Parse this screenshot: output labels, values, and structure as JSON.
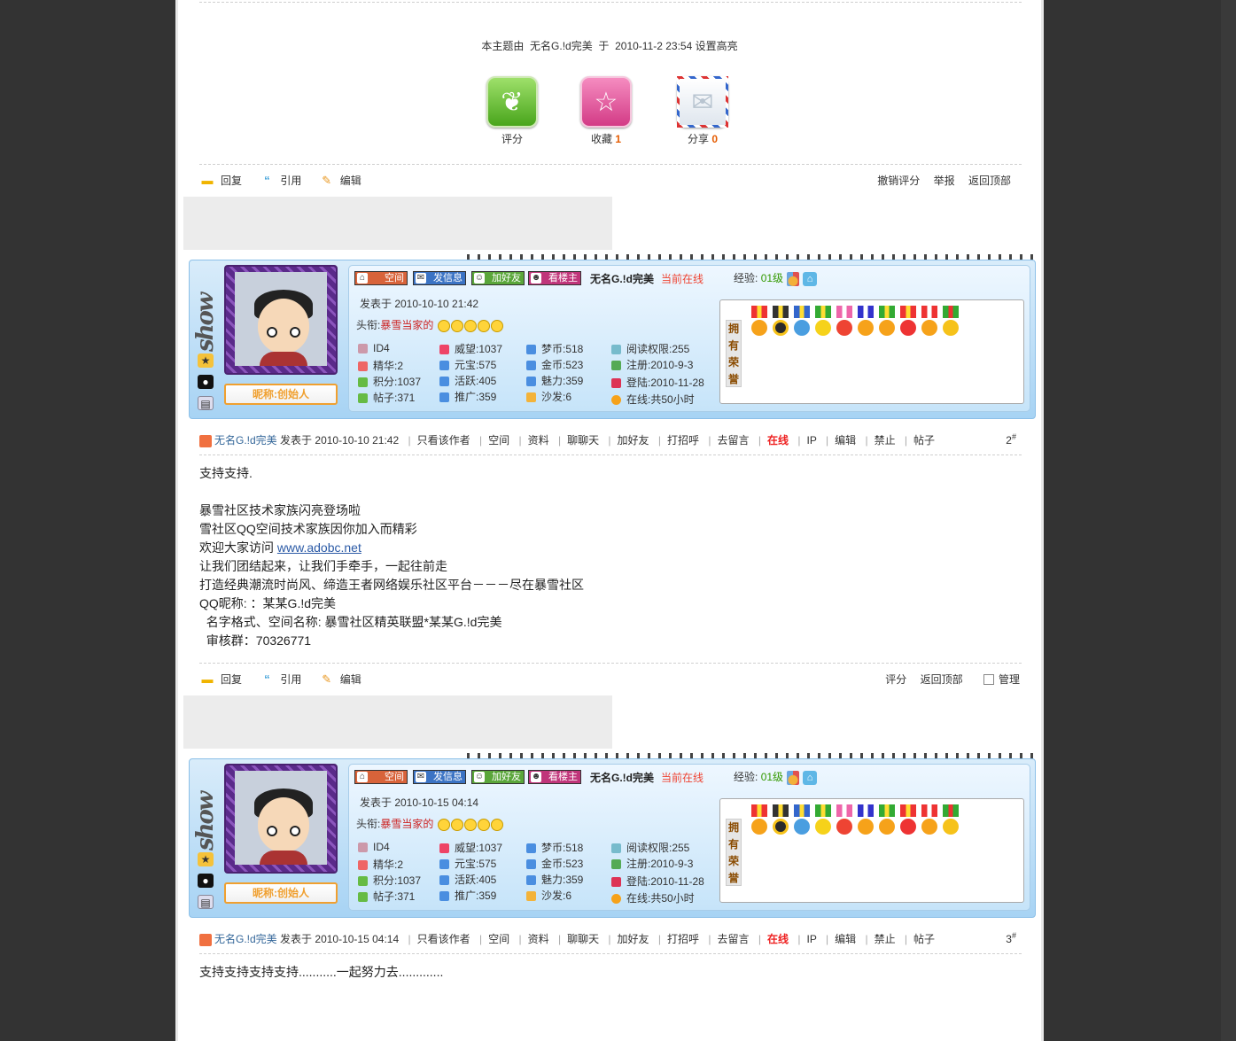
{
  "highlight_note": {
    "prefix": "本主题由",
    "user": "无名G.!d完美",
    "at": "于",
    "time": "2010-11-2 23:54",
    "suffix": "设置高亮"
  },
  "share": {
    "rate_label": "评分",
    "fav_label": "收藏",
    "fav_count": "1",
    "share_label": "分享",
    "share_count": "0"
  },
  "actions": {
    "reply": "回复",
    "quote": "引用",
    "edit": "编辑",
    "undo_rate": "撤销评分",
    "report": "举报",
    "back_top": "返回顶部",
    "rate": "评分",
    "manage": "管理"
  },
  "card_buttons": {
    "space": "空间",
    "message": "发信息",
    "add_friend": "加好友",
    "view_host": "看楼主"
  },
  "profile": {
    "username": "无名G.!d完美",
    "status": "当前在线",
    "exp_label": "经验:",
    "exp_level": "01级",
    "nick": "昵称:创始人",
    "rank_label": "头衔:",
    "rank_name": "暴雪当家的",
    "medal_tag": [
      "拥",
      "有",
      "荣",
      "誉"
    ],
    "stats": {
      "id": "ID4",
      "prestige": "威望:1037",
      "dream": "梦币:518",
      "read": "阅读权限:255",
      "essence": "精华:2",
      "yuanbao": "元宝:575",
      "gold": "金币:523",
      "register": "注册:2010-9-3",
      "points": "积分:1037",
      "active": "活跃:405",
      "charm": "魅力:359",
      "login": "登陆:2010-11-28",
      "posts": "帖子:371",
      "promote": "推广:359",
      "sofa": "沙发:6",
      "online": "在线:共50小时"
    }
  },
  "colors": {
    "accent_online": "#ee2222",
    "link": "#336699",
    "panel_top": "#eef7ff",
    "panel_bottom": "#c6e4f9"
  },
  "meta_links": {
    "posted_at": "发表于",
    "only_author": "只看该作者",
    "space": "空间",
    "profile": "资料",
    "chat": "聊聊天",
    "add_friend": "加好友",
    "greet": "打招呼",
    "leave_msg": "去留言",
    "online": "在线",
    "ip": "IP",
    "edit": "编辑",
    "ban": "禁止",
    "posts": "帖子"
  },
  "posts": [
    {
      "post_time": "发表于  2010-10-10 21:42",
      "meta_time": "2010-10-10 21:42",
      "floor": "2",
      "body": [
        "支持支持.",
        "",
        "暴雪社区技术家族闪亮登场啦",
        "雪社区QQ空间技术家族因你加入而精彩",
        "欢迎大家访问",
        "让我们团结起来，让我们手牵手，一起往前走",
        "打造经典潮流时尚风、缔造王者网络娱乐社区平台－－－尽在暴雪社区",
        "QQ昵称: ：某某G.!d完美",
        "  名字格式、空间名称: 暴雪社区精英联盟*某某G.!d完美",
        "  审核群：70326771"
      ],
      "link": "www.adobc.net"
    },
    {
      "post_time": "发表于  2010-10-15 04:14",
      "meta_time": "2010-10-15 04:14",
      "floor": "3",
      "body_text": "支持支持支持支持...........一起努力去............."
    }
  ]
}
